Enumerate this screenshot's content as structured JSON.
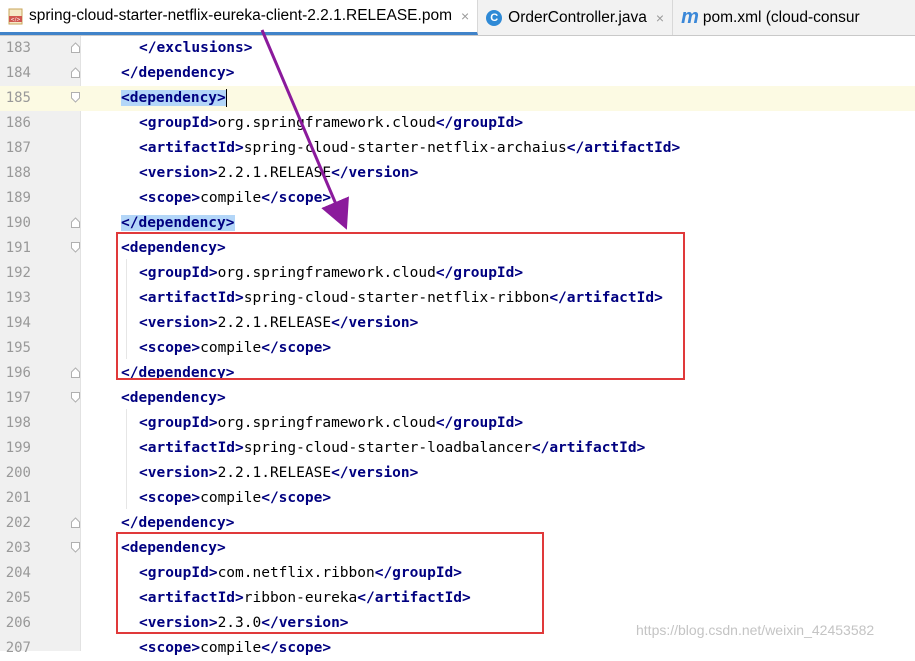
{
  "tabs": [
    {
      "label": "spring-cloud-starter-netflix-eureka-client-2.2.1.RELEASE.pom",
      "icon": "xml-file-icon",
      "active": true
    },
    {
      "label": "OrderController.java",
      "icon": "java-class-icon",
      "active": false
    },
    {
      "label": "pom.xml (cloud-consur",
      "icon": "maven-icon",
      "active": false
    }
  ],
  "close_glyph": "×",
  "lines": [
    {
      "n": "183",
      "indent": 1,
      "parts": [
        [
          "tag",
          "</exclusions>"
        ]
      ]
    },
    {
      "n": "184",
      "indent": 0,
      "parts": [
        [
          "tag",
          "</dependency>"
        ]
      ]
    },
    {
      "n": "185",
      "indent": 0,
      "current": true,
      "parts": [
        [
          "hl",
          "<dependency>"
        ]
      ]
    },
    {
      "n": "186",
      "indent": 1,
      "parts": [
        [
          "tag",
          "<groupId>"
        ],
        [
          "txt",
          "org.springframework.cloud"
        ],
        [
          "tag",
          "</groupId>"
        ]
      ]
    },
    {
      "n": "187",
      "indent": 1,
      "parts": [
        [
          "tag",
          "<artifactId>"
        ],
        [
          "txt",
          "spring-cloud-starter-netflix-archaius"
        ],
        [
          "tag",
          "</artifactId>"
        ]
      ]
    },
    {
      "n": "188",
      "indent": 1,
      "parts": [
        [
          "tag",
          "<version>"
        ],
        [
          "txt",
          "2.2.1.RELEASE"
        ],
        [
          "tag",
          "</version>"
        ]
      ]
    },
    {
      "n": "189",
      "indent": 1,
      "parts": [
        [
          "tag",
          "<scope>"
        ],
        [
          "txt",
          "compile"
        ],
        [
          "tag",
          "</scope>"
        ]
      ]
    },
    {
      "n": "190",
      "indent": 0,
      "parts": [
        [
          "hl",
          "</dependency>"
        ]
      ]
    },
    {
      "n": "191",
      "indent": 0,
      "parts": [
        [
          "tag",
          "<dependency>"
        ]
      ]
    },
    {
      "n": "192",
      "indent": 1,
      "parts": [
        [
          "tag",
          "<groupId>"
        ],
        [
          "txt",
          "org.springframework.cloud"
        ],
        [
          "tag",
          "</groupId>"
        ]
      ]
    },
    {
      "n": "193",
      "indent": 1,
      "parts": [
        [
          "tag",
          "<artifactId>"
        ],
        [
          "txt",
          "spring-cloud-starter-netflix-ribbon"
        ],
        [
          "tag",
          "</artifactId>"
        ]
      ]
    },
    {
      "n": "194",
      "indent": 1,
      "parts": [
        [
          "tag",
          "<version>"
        ],
        [
          "txt",
          "2.2.1.RELEASE"
        ],
        [
          "tag",
          "</version>"
        ]
      ]
    },
    {
      "n": "195",
      "indent": 1,
      "parts": [
        [
          "tag",
          "<scope>"
        ],
        [
          "txt",
          "compile"
        ],
        [
          "tag",
          "</scope>"
        ]
      ]
    },
    {
      "n": "196",
      "indent": 0,
      "parts": [
        [
          "tag",
          "</dependency>"
        ]
      ]
    },
    {
      "n": "197",
      "indent": 0,
      "parts": [
        [
          "tag",
          "<dependency>"
        ]
      ]
    },
    {
      "n": "198",
      "indent": 1,
      "parts": [
        [
          "tag",
          "<groupId>"
        ],
        [
          "txt",
          "org.springframework.cloud"
        ],
        [
          "tag",
          "</groupId>"
        ]
      ]
    },
    {
      "n": "199",
      "indent": 1,
      "parts": [
        [
          "tag",
          "<artifactId>"
        ],
        [
          "txt",
          "spring-cloud-starter-loadbalancer"
        ],
        [
          "tag",
          "</artifactId>"
        ]
      ]
    },
    {
      "n": "200",
      "indent": 1,
      "parts": [
        [
          "tag",
          "<version>"
        ],
        [
          "txt",
          "2.2.1.RELEASE"
        ],
        [
          "tag",
          "</version>"
        ]
      ]
    },
    {
      "n": "201",
      "indent": 1,
      "parts": [
        [
          "tag",
          "<scope>"
        ],
        [
          "txt",
          "compile"
        ],
        [
          "tag",
          "</scope>"
        ]
      ]
    },
    {
      "n": "202",
      "indent": 0,
      "parts": [
        [
          "tag",
          "</dependency>"
        ]
      ]
    },
    {
      "n": "203",
      "indent": 0,
      "parts": [
        [
          "tag",
          "<dependency>"
        ]
      ]
    },
    {
      "n": "204",
      "indent": 1,
      "parts": [
        [
          "tag",
          "<groupId>"
        ],
        [
          "txt",
          "com.netflix.ribbon"
        ],
        [
          "tag",
          "</groupId>"
        ]
      ]
    },
    {
      "n": "205",
      "indent": 1,
      "parts": [
        [
          "tag",
          "<artifactId>"
        ],
        [
          "txt",
          "ribbon-eureka"
        ],
        [
          "tag",
          "</artifactId>"
        ]
      ]
    },
    {
      "n": "206",
      "indent": 1,
      "parts": [
        [
          "tag",
          "<version>"
        ],
        [
          "txt",
          "2.3.0"
        ],
        [
          "tag",
          "</version>"
        ]
      ]
    },
    {
      "n": "207",
      "indent": 1,
      "parts": [
        [
          "tag",
          "<scope>"
        ],
        [
          "txt",
          "compile"
        ],
        [
          "tag",
          "</scope>"
        ]
      ]
    }
  ],
  "watermark": "https://blog.csdn.net/weixin_42453582",
  "colors": {
    "tag": "#000080",
    "highlight": "#b3d6f8",
    "annotation_box": "#e0393a",
    "annotation_arrow": "#8b1a9c",
    "tab_underline": "#4083c9"
  }
}
